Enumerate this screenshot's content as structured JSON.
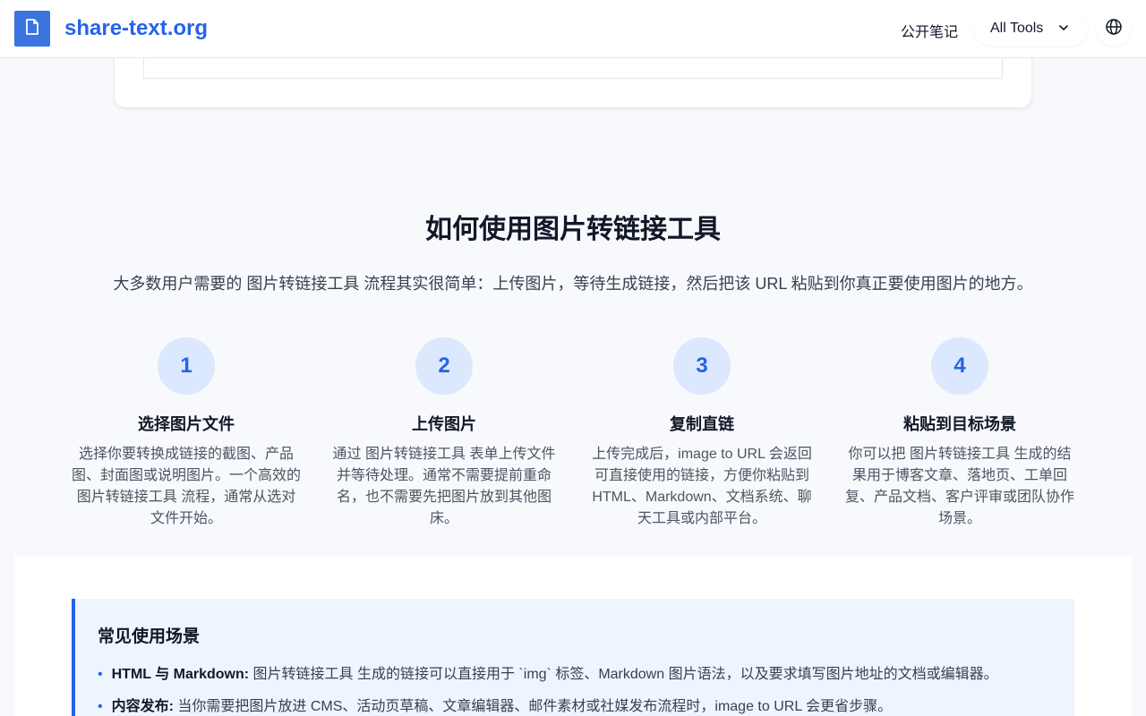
{
  "header": {
    "brand": "share-text.org",
    "nav_notes": "公开笔记",
    "tools_label": "All Tools",
    "icons": {
      "logo": "document-icon",
      "tools": "chevron-down-icon",
      "language": "globe-icon"
    }
  },
  "how_to": {
    "title": "如何使用图片转链接工具",
    "subtitle": "大多数用户需要的 图片转链接工具 流程其实很简单：上传图片，等待生成链接，然后把该 URL 粘贴到你真正要使用图片的地方。",
    "steps": [
      {
        "number": "1",
        "title": "选择图片文件",
        "description": "选择你要转换成链接的截图、产品图、封面图或说明图片。一个高效的 图片转链接工具 流程，通常从选对文件开始。"
      },
      {
        "number": "2",
        "title": "上传图片",
        "description": "通过 图片转链接工具 表单上传文件并等待处理。通常不需要提前重命名，也不需要先把图片放到其他图床。"
      },
      {
        "number": "3",
        "title": "复制直链",
        "description": "上传完成后，image to URL 会返回可直接使用的链接，方便你粘贴到 HTML、Markdown、文档系统、聊天工具或内部平台。"
      },
      {
        "number": "4",
        "title": "粘贴到目标场景",
        "description": "你可以把 图片转链接工具 生成的结果用于博客文章、落地页、工单回复、产品文档、客户评审或团队协作场景。"
      }
    ]
  },
  "use_cases": {
    "title": "常见使用场景",
    "items": [
      {
        "label": "HTML 与 Markdown:",
        "text": " 图片转链接工具 生成的链接可以直接用于 `img` 标签、Markdown 图片语法，以及要求填写图片地址的文档或编辑器。"
      },
      {
        "label": "内容发布:",
        "text": " 当你需要把图片放进 CMS、活动页草稿、文章编辑器、邮件素材或社媒发布流程时，image to URL 会更省步骤。"
      }
    ]
  },
  "colors": {
    "accent": "#2563eb",
    "logo_bg": "#3b73e0",
    "step_circle": "#dbe8fd",
    "usecase_bg": "#eff5ff"
  }
}
